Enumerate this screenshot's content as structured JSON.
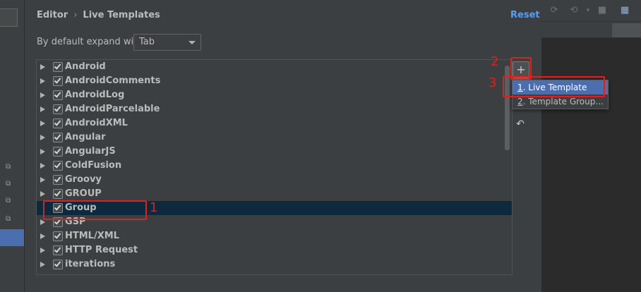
{
  "header": {
    "breadcrumb_parent": "Editor",
    "breadcrumb_separator": "›",
    "breadcrumb_current": "Live Templates",
    "reset_label": "Reset"
  },
  "expand": {
    "label": "By default expand with",
    "value": "Tab"
  },
  "template_groups": [
    {
      "label": "Android",
      "checked": true
    },
    {
      "label": "AndroidComments",
      "checked": true
    },
    {
      "label": "AndroidLog",
      "checked": true
    },
    {
      "label": "AndroidParcelable",
      "checked": true
    },
    {
      "label": "AndroidXML",
      "checked": true
    },
    {
      "label": "Angular",
      "checked": true
    },
    {
      "label": "AngularJS",
      "checked": true
    },
    {
      "label": "ColdFusion",
      "checked": true
    },
    {
      "label": "Groovy",
      "checked": true
    },
    {
      "label": "GROUP",
      "checked": true
    },
    {
      "label": "Group",
      "checked": true,
      "selected": true
    },
    {
      "label": "GSP",
      "checked": true
    },
    {
      "label": "HTML/XML",
      "checked": true
    },
    {
      "label": "HTTP Request",
      "checked": true
    },
    {
      "label": "iterations",
      "checked": true
    }
  ],
  "add_menu": {
    "item1_num": "1",
    "item1_text": ". Live Template",
    "item2_num": "2",
    "item2_text": ". Template Group..."
  },
  "annotations": {
    "n1": "1",
    "n2": "2",
    "n3": "3"
  },
  "icons": {
    "add": "plus-icon",
    "restore": "undo-icon",
    "expand": "triangle-right-icon"
  },
  "colors": {
    "accent": "#589df6",
    "selection": "#0d293e",
    "menu_highlight": "#4b6eaf",
    "annotation": "#e0201a"
  }
}
